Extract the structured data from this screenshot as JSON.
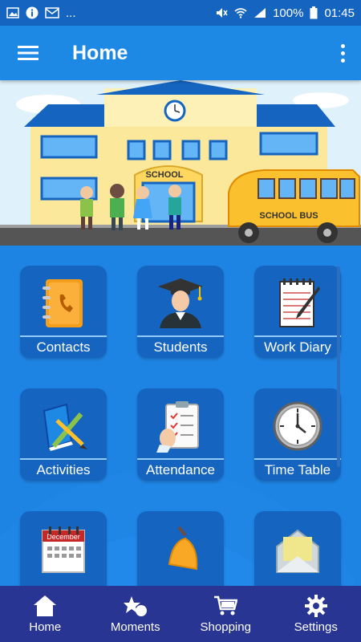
{
  "status_bar": {
    "left_icons": [
      "image-icon",
      "info-icon",
      "mail-icon",
      "more-dots-icon"
    ],
    "more_text": "...",
    "battery": "100%",
    "time": "01:45",
    "right_icons": [
      "mute-icon",
      "wifi-icon",
      "signal-icon",
      "battery-icon"
    ]
  },
  "app_bar": {
    "title": "Home",
    "menu_icon": "hamburger-icon",
    "overflow_icon": "more-vertical-icon",
    "color": "#1e88e5"
  },
  "banner": {
    "school_sign": "SCHOOL",
    "bus_sign": "SCHOOL BUS"
  },
  "tiles": [
    {
      "label": "Contacts",
      "icon": "address-book-icon"
    },
    {
      "label": "Students",
      "icon": "graduate-student-icon"
    },
    {
      "label": "Work Diary",
      "icon": "notepad-icon"
    },
    {
      "label": "Activities",
      "icon": "book-pencil-icon"
    },
    {
      "label": "Attendance",
      "icon": "clipboard-checklist-icon"
    },
    {
      "label": "Time Table",
      "icon": "clock-icon"
    },
    {
      "label": "",
      "icon": "calendar-icon",
      "calendar_month": "December"
    },
    {
      "label": "",
      "icon": "bell-icon"
    },
    {
      "label": "",
      "icon": "envelope-icon"
    }
  ],
  "bottom_nav": [
    {
      "label": "Home",
      "icon": "home-icon"
    },
    {
      "label": "Moments",
      "icon": "moments-star-icon"
    },
    {
      "label": "Shopping",
      "icon": "shopping-cart-icon"
    },
    {
      "label": "Settings",
      "icon": "gear-icon"
    }
  ],
  "colors": {
    "primary": "#1e88e5",
    "status_bar": "#1565c0",
    "tile": "#1565c0",
    "bottom_nav": "#283593"
  }
}
